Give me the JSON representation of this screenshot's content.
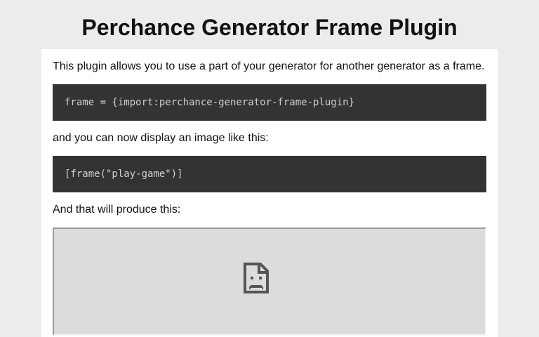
{
  "page": {
    "title": "Perchance Generator Frame Plugin"
  },
  "content": {
    "intro": "This plugin allows you to use a part of your generator for another generator as a frame.",
    "import_code": "frame = {import:perchance-generator-frame-plugin}",
    "display_text": "and you can now display an image like this:",
    "usage_code": "[frame(\"play-game\")]",
    "result_text": "And that will produce this:"
  },
  "frame_preview": {
    "icon": "broken-page-icon"
  }
}
